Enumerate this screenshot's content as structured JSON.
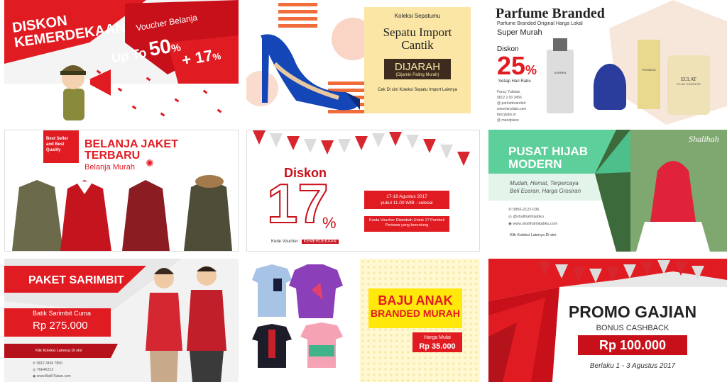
{
  "colors": {
    "red": "#e11b22",
    "dark_red": "#b5121b",
    "green": "#5ccf9a",
    "mint": "#e3f4ea",
    "yellow": "#ffe80a",
    "cream": "#fbe6a6"
  },
  "tile1": {
    "title_line1": "DISKON",
    "title_line2": "KEMERDEKAAN",
    "voucher_label": "Voucher Belanja",
    "up_to": "Up To",
    "percent1": "50",
    "pct_sign": "%",
    "plus": "+ 17",
    "pct_sign2": "%"
  },
  "tile2": {
    "kicker": "Koleksi Sepatumu",
    "title_line1": "Sepatu Import",
    "title_line2": "Cantik",
    "stamp": "DIJARAH",
    "stamp_sub": "(Dijamin Paling Murah)",
    "footer": "Cek Di sini Koleksi Sepatu Import Lainnya"
  },
  "tile3": {
    "title": "Parfume Branded",
    "subtitle": "Parfume Branded Original Harga Lokal",
    "tagline": "Super Murah",
    "discount_label": "Diskon",
    "discount": "25",
    "pct_sign": "%",
    "note": "Setiap Hari Rabu",
    "contacts": [
      "Fancy Yulistan",
      "0812 2 00 3456",
      "@ parfumbranded",
      "www.fanylabs.com",
      "fancylabs.id",
      "@ moodplace"
    ],
    "bottle_labels": [
      "SURREN",
      "POSSESS",
      "ECLAT",
      "ECLAT D'ARPEGE"
    ]
  },
  "tile4": {
    "badge": "Best Seller and Best Quality",
    "title_line1": "BELANJA JAKET",
    "title_line2": "TERBARU",
    "sub": "Belanja Murah"
  },
  "tile5": {
    "diskon": "Diskon",
    "big": "17",
    "pct": "%",
    "dates": "17-18 Agustus 2017",
    "time": "pukul 11.00 WIB - selesai",
    "quota": "Kuota Voucher Ditambah Untuk 17 Pembeli Pertama yang beruntung",
    "code_label": "Kode Voucher :",
    "code": "KEMERDEKAAN"
  },
  "tile6": {
    "brand": "Shalihah",
    "title_line1": "PUSAT HIJAB",
    "title_line2": "MODERN",
    "tag1": "Mudah, Hemat, Terpercaya",
    "tag2": "Beli Eceran, Harga Grosiran",
    "contacts": [
      "0856-2122-036",
      "@shalihahhijabku",
      "www.shalihahhijabku.com"
    ],
    "cta": "Klik Koleksi Lainnya Di sini"
  },
  "tile7": {
    "title": "PAKET SARIMBIT",
    "label": "Batik Sarimbit Cuma",
    "price": "Rp 275.000",
    "cta": "Klik Koleksi Lainnya Di sini",
    "contacts": [
      "0812 3456 7890",
      "76E4K213",
      "www.BatikTuban.com"
    ]
  },
  "tile8": {
    "title_line1": "BAJU ANAK",
    "title_line2": "BRANDED MURAH",
    "price_label": "Harga Mulai",
    "price": "Rp 35.000"
  },
  "tile9": {
    "title": "PROMO GAJIAN",
    "sub": "BONUS CASHBACK",
    "price": "Rp 100.000",
    "dates": "Berlaku 1 - 3 Agustus 2017"
  }
}
